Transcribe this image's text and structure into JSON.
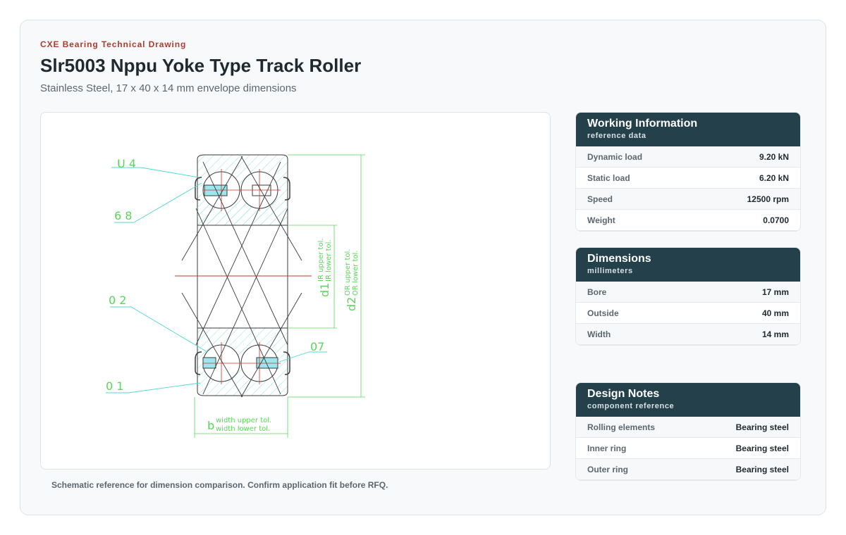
{
  "header": {
    "eyebrow": "CXE Bearing Technical Drawing",
    "title": "Slr5003 Nppu Yoke Type Track Roller",
    "subtitle": "Stainless Steel, 17 x 40 x 14 mm envelope dimensions"
  },
  "drawing": {
    "labels": {
      "u4": "U 4",
      "l68": "6 8",
      "l02": "0 2",
      "l01": "0 1",
      "l07": "07",
      "d1": "d1",
      "d1_upper": "IR upper tol.",
      "d1_lower": "IR lower tol.",
      "d2": "d2",
      "d2_upper": "OR upper tol.",
      "d2_lower": "OR lower tol.",
      "b": "b",
      "b_upper": "width upper tol.",
      "b_lower": "width lower tol."
    },
    "colors": {
      "dim": "#5ad65a",
      "leader": "#4fd7d7",
      "outline": "#3a3a3a",
      "centerline": "#c0392b",
      "seal": "#9ee6ee"
    }
  },
  "caption": "Schematic reference for dimension comparison. Confirm application fit before RFQ.",
  "working": {
    "title": "Working Information",
    "subtitle": "reference data",
    "rows": [
      {
        "label": "Dynamic load",
        "value": "9.20 kN"
      },
      {
        "label": "Static load",
        "value": "6.20 kN"
      },
      {
        "label": "Speed",
        "value": "12500 rpm"
      },
      {
        "label": "Weight",
        "value": "0.0700"
      }
    ]
  },
  "dimensions": {
    "title": "Dimensions",
    "subtitle": "millimeters",
    "rows": [
      {
        "label": "Bore",
        "value": "17 mm"
      },
      {
        "label": "Outside",
        "value": "40 mm"
      },
      {
        "label": "Width",
        "value": "14 mm"
      }
    ]
  },
  "notes": {
    "title": "Design Notes",
    "subtitle": "component reference",
    "rows": [
      {
        "label": "Rolling elements",
        "value": "Bearing steel"
      },
      {
        "label": "Inner ring",
        "value": "Bearing steel"
      },
      {
        "label": "Outer ring",
        "value": "Bearing steel"
      }
    ]
  }
}
